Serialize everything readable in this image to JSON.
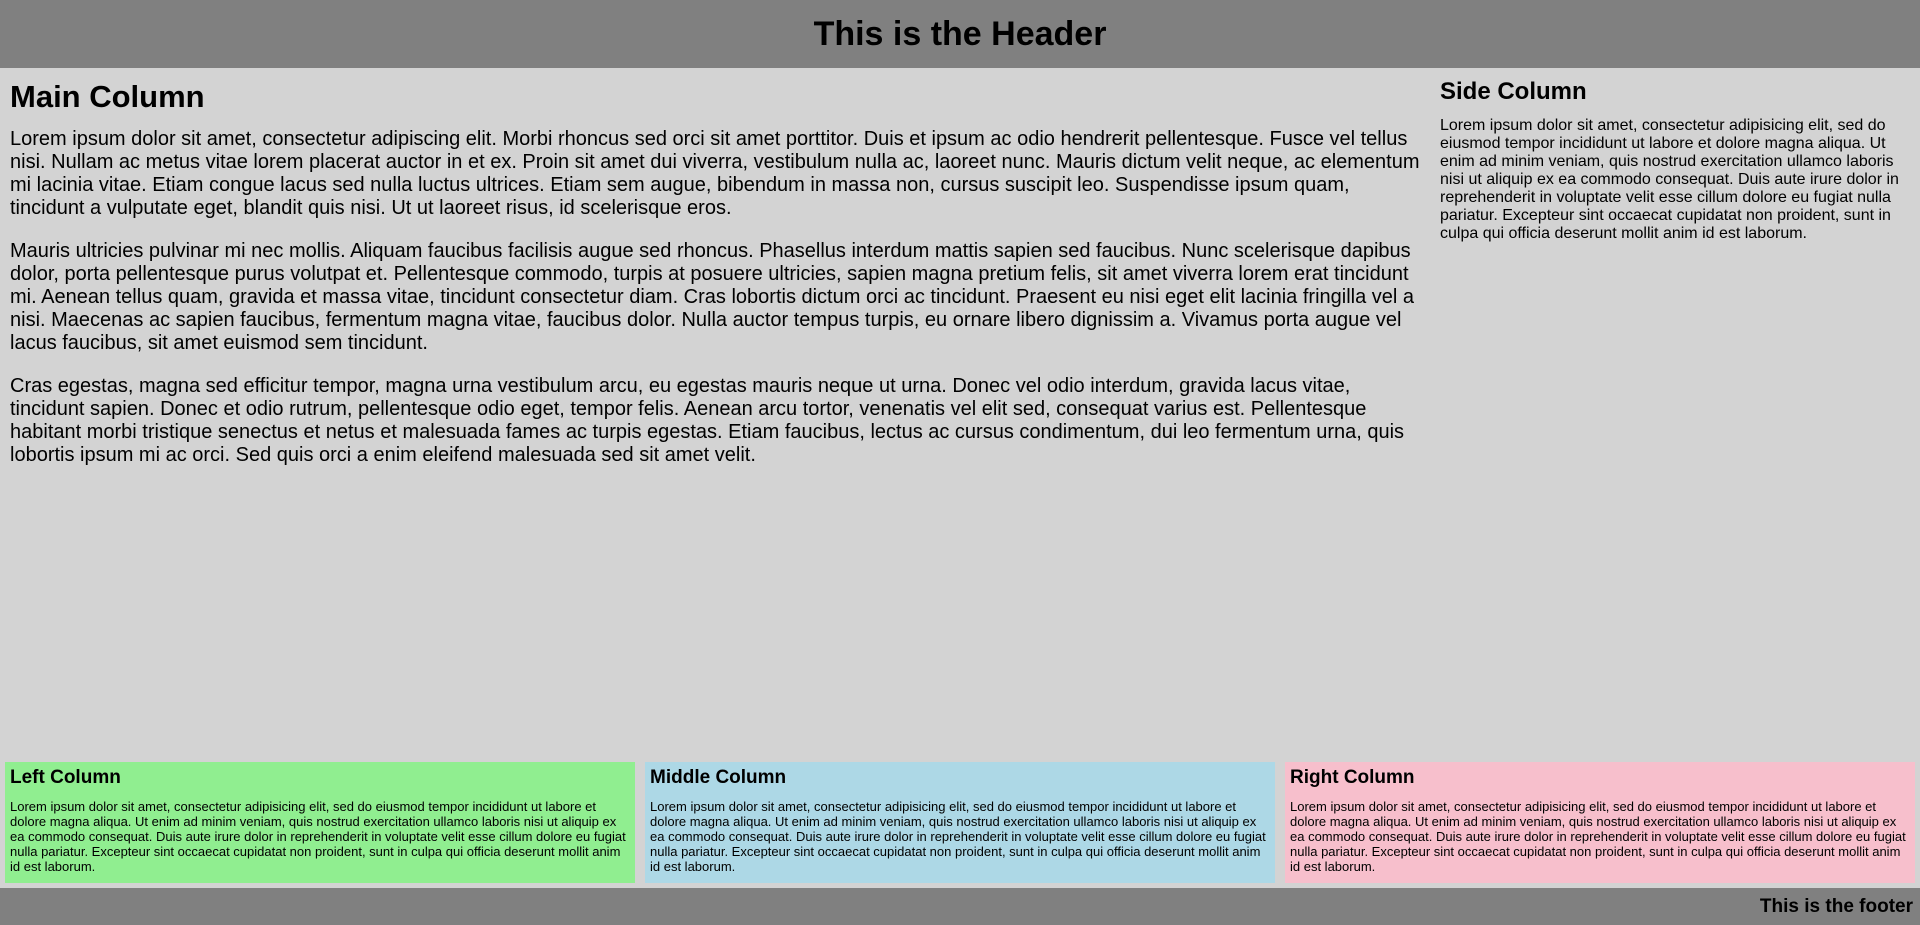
{
  "header": {
    "title": "This is the Header"
  },
  "main": {
    "heading": "Main Column",
    "paragraphs": [
      "Lorem ipsum dolor sit amet, consectetur adipiscing elit. Morbi rhoncus sed orci sit amet porttitor. Duis et ipsum ac odio hendrerit pellentesque. Fusce vel tellus nisi. Nullam ac metus vitae lorem placerat auctor in et ex. Proin sit amet dui viverra, vestibulum nulla ac, laoreet nunc. Mauris dictum velit neque, ac elementum mi lacinia vitae. Etiam congue lacus sed nulla luctus ultrices. Etiam sem augue, bibendum in massa non, cursus suscipit leo. Suspendisse ipsum quam, tincidunt a vulputate eget, blandit quis nisi. Ut ut laoreet risus, id scelerisque eros.",
      "Mauris ultricies pulvinar mi nec mollis. Aliquam faucibus facilisis augue sed rhoncus. Phasellus interdum mattis sapien sed faucibus. Nunc scelerisque dapibus dolor, porta pellentesque purus volutpat et. Pellentesque commodo, turpis at posuere ultricies, sapien magna pretium felis, sit amet viverra lorem erat tincidunt mi. Aenean tellus quam, gravida et massa vitae, tincidunt consectetur diam. Cras lobortis dictum orci ac tincidunt. Praesent eu nisi eget elit lacinia fringilla vel a nisi. Maecenas ac sapien faucibus, fermentum magna vitae, faucibus dolor. Nulla auctor tempus turpis, eu ornare libero dignissim a. Vivamus porta augue vel lacus faucibus, sit amet euismod sem tincidunt.",
      "Cras egestas, magna sed efficitur tempor, magna urna vestibulum arcu, eu egestas mauris neque ut urna. Donec vel odio interdum, gravida lacus vitae, tincidunt sapien. Donec et odio rutrum, pellentesque odio eget, tempor felis. Aenean arcu tortor, venenatis vel elit sed, consequat varius est. Pellentesque habitant morbi tristique senectus et netus et malesuada fames ac turpis egestas. Etiam faucibus, lectus ac cursus condimentum, dui leo fermentum urna, quis lobortis ipsum mi ac orci. Sed quis orci a enim eleifend malesuada sed sit amet velit."
    ]
  },
  "side": {
    "heading": "Side Column",
    "text": "Lorem ipsum dolor sit amet, consectetur adipisicing elit, sed do eiusmod tempor incididunt ut labore et dolore magna aliqua. Ut enim ad minim veniam, quis nostrud exercitation ullamco laboris nisi ut aliquip ex ea commodo consequat. Duis aute irure dolor in reprehenderit in voluptate velit esse cillum dolore eu fugiat nulla pariatur. Excepteur sint occaecat cupidatat non proident, sunt in culpa qui officia deserunt mollit anim id est laborum."
  },
  "columns": {
    "left": {
      "heading": "Left Column",
      "text": "Lorem ipsum dolor sit amet, consectetur adipisicing elit, sed do eiusmod tempor incididunt ut labore et dolore magna aliqua. Ut enim ad minim veniam, quis nostrud exercitation ullamco laboris nisi ut aliquip ex ea commodo consequat. Duis aute irure dolor in reprehenderit in voluptate velit esse cillum dolore eu fugiat nulla pariatur. Excepteur sint occaecat cupidatat non proident, sunt in culpa qui officia deserunt mollit anim id est laborum.",
      "color": "#90ee90"
    },
    "middle": {
      "heading": "Middle Column",
      "text": "Lorem ipsum dolor sit amet, consectetur adipisicing elit, sed do eiusmod tempor incididunt ut labore et dolore magna aliqua. Ut enim ad minim veniam, quis nostrud exercitation ullamco laboris nisi ut aliquip ex ea commodo consequat. Duis aute irure dolor in reprehenderit in voluptate velit esse cillum dolore eu fugiat nulla pariatur. Excepteur sint occaecat cupidatat non proident, sunt in culpa qui officia deserunt mollit anim id est laborum.",
      "color": "#add8e6"
    },
    "right": {
      "heading": "Right Column",
      "text": "Lorem ipsum dolor sit amet, consectetur adipisicing elit, sed do eiusmod tempor incididunt ut labore et dolore magna aliqua. Ut enim ad minim veniam, quis nostrud exercitation ullamco laboris nisi ut aliquip ex ea commodo consequat. Duis aute irure dolor in reprehenderit in voluptate velit esse cillum dolore eu fugiat nulla pariatur. Excepteur sint occaecat cupidatat non proident, sunt in culpa qui officia deserunt mollit anim id est laborum.",
      "color": "#f7bfcc"
    }
  },
  "footer": {
    "text": "This is the footer"
  },
  "colors": {
    "header_footer_bg": "#808080",
    "page_bg": "#d3d3d3"
  }
}
